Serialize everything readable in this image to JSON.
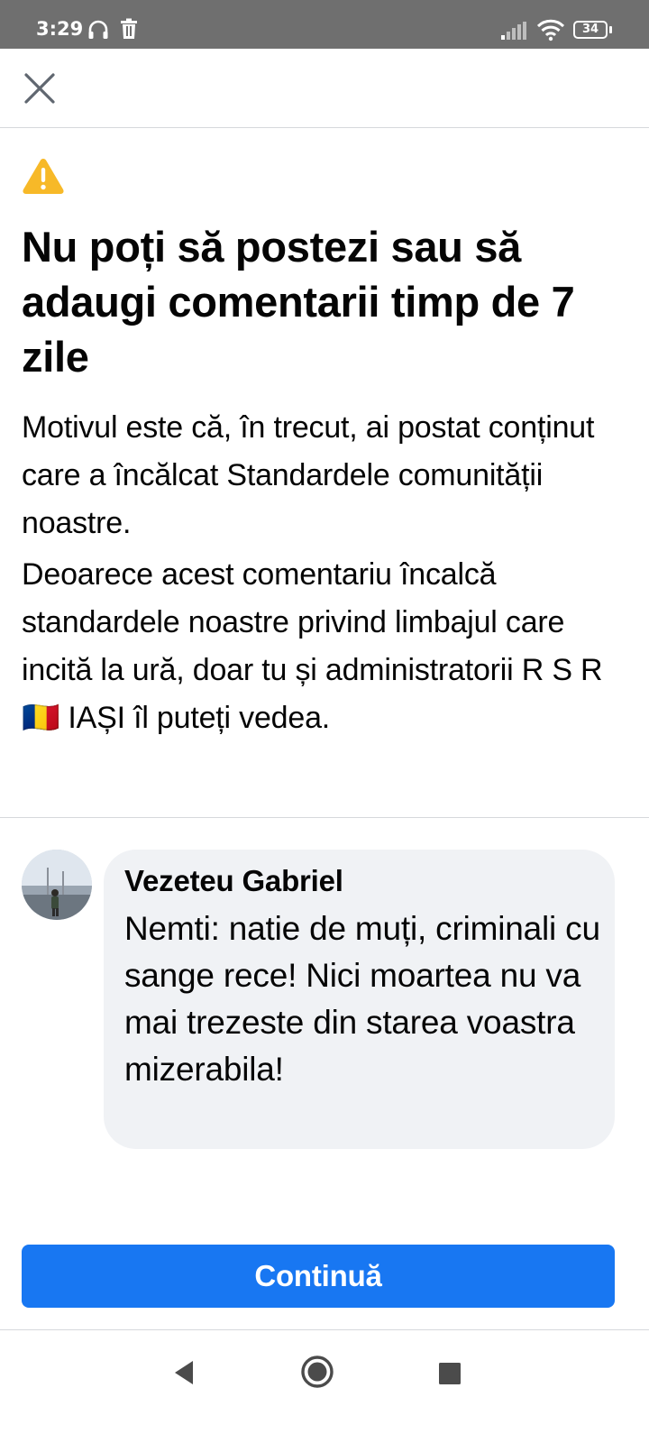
{
  "status_bar": {
    "time": "3:29",
    "battery": "34",
    "icons": [
      "headset-icon",
      "trash-icon",
      "signal-icon",
      "wifi-icon",
      "battery-icon"
    ]
  },
  "header": {
    "close_icon": "close-icon"
  },
  "notice": {
    "icon": "warning-icon",
    "icon_color": "#f7b928",
    "title": "Nu poți să postezi sau să adaugi comentarii timp de 7 zile",
    "reason": "Motivul este că, în trecut, ai postat conținut care a încălcat Standardele comunității noastre.",
    "explanation": "Deoarece acest comentariu încalcă standardele noastre privind limbajul care incită la ură, doar tu și administratorii R S R 🇷🇴 IAȘI îl puteți vedea."
  },
  "comment": {
    "author": "Vezeteu Gabriel",
    "text": "Nemti: natie de muți, criminali cu sange rece! Nici moartea nu va mai trezeste din starea voastra mizerabila!",
    "bubble_color": "#f0f2f5"
  },
  "actions": {
    "continue_label": "Continuă",
    "button_color": "#1877f2"
  },
  "nav_bar": {
    "icons": [
      "back-icon",
      "home-icon",
      "recents-icon"
    ]
  }
}
